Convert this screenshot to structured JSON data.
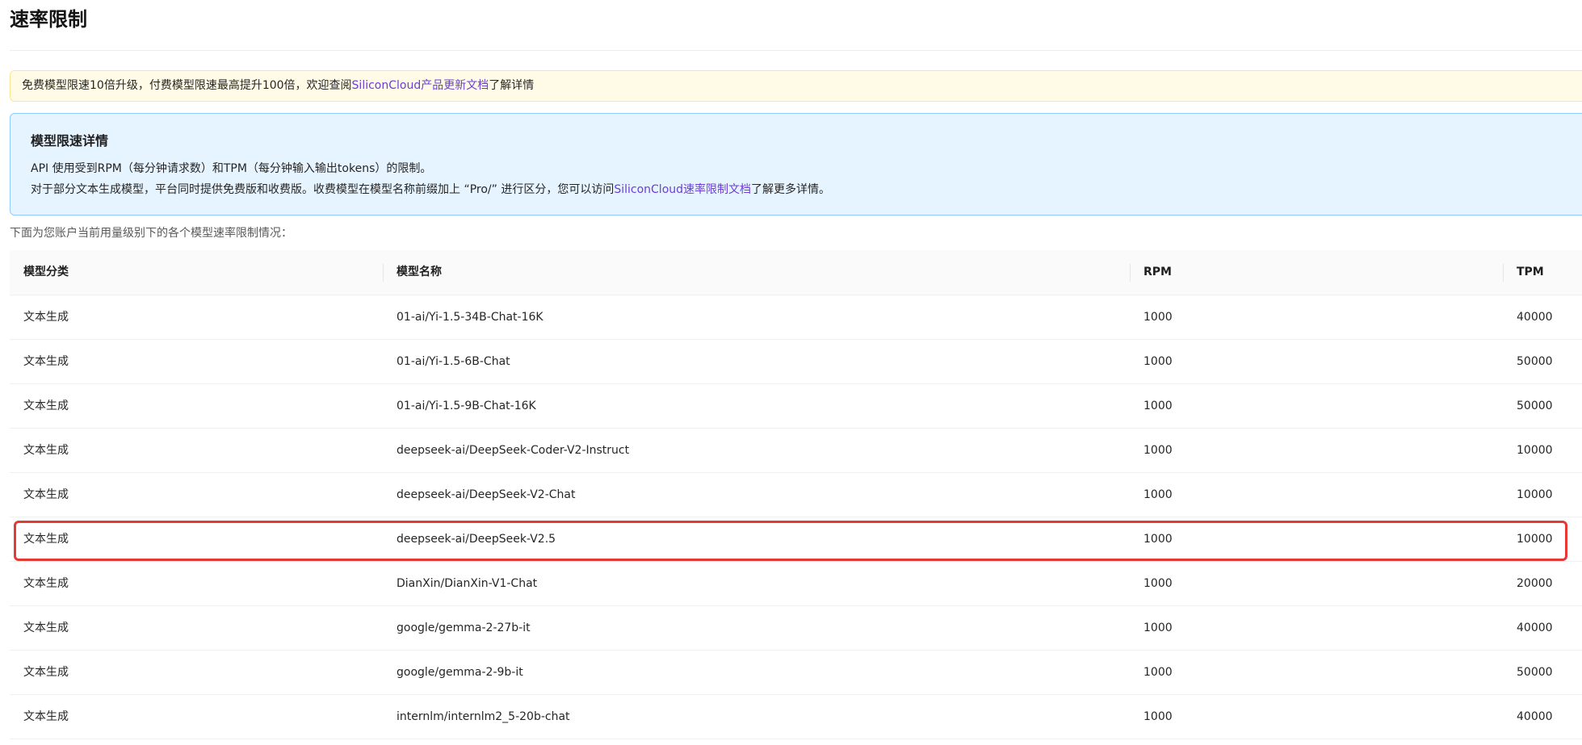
{
  "page": {
    "title": "速率限制"
  },
  "notice": {
    "text_before": "免费模型限速10倍升级，付费模型限速最高提升100倍，欢迎查阅",
    "link_text": "SiliconCloud产品更新文档",
    "text_after": "了解详情"
  },
  "info": {
    "title": "模型限速详情",
    "line1": "API 使用受到RPM（每分钟请求数）和TPM（每分钟输入输出tokens）的限制。",
    "line2_before": "对于部分文本生成模型，平台同时提供免费版和收费版。收费模型在模型名称前缀加上 “Pro/” 进行区分，您可以访问",
    "line2_link": "SiliconCloud速率限制文档",
    "line2_after": "了解更多详情。"
  },
  "table": {
    "caption": "下面为您账户当前用量级别下的各个模型速率限制情况：",
    "headers": {
      "category": "模型分类",
      "model": "模型名称",
      "rpm": "RPM",
      "tpm": "TPM"
    },
    "rows": [
      {
        "category": "文本生成",
        "model": "01-ai/Yi-1.5-34B-Chat-16K",
        "rpm": "1000",
        "tpm": "40000"
      },
      {
        "category": "文本生成",
        "model": "01-ai/Yi-1.5-6B-Chat",
        "rpm": "1000",
        "tpm": "50000"
      },
      {
        "category": "文本生成",
        "model": "01-ai/Yi-1.5-9B-Chat-16K",
        "rpm": "1000",
        "tpm": "50000"
      },
      {
        "category": "文本生成",
        "model": "deepseek-ai/DeepSeek-Coder-V2-Instruct",
        "rpm": "1000",
        "tpm": "10000"
      },
      {
        "category": "文本生成",
        "model": "deepseek-ai/DeepSeek-V2-Chat",
        "rpm": "1000",
        "tpm": "10000"
      },
      {
        "category": "文本生成",
        "model": "deepseek-ai/DeepSeek-V2.5",
        "rpm": "1000",
        "tpm": "10000"
      },
      {
        "category": "文本生成",
        "model": "DianXin/DianXin-V1-Chat",
        "rpm": "1000",
        "tpm": "20000"
      },
      {
        "category": "文本生成",
        "model": "google/gemma-2-27b-it",
        "rpm": "1000",
        "tpm": "40000"
      },
      {
        "category": "文本生成",
        "model": "google/gemma-2-9b-it",
        "rpm": "1000",
        "tpm": "50000"
      },
      {
        "category": "文本生成",
        "model": "internlm/internlm2_5-20b-chat",
        "rpm": "1000",
        "tpm": "40000"
      }
    ],
    "highlighted_row": 5
  },
  "colors": {
    "link": "#6b3fd6",
    "highlight": "#e53935",
    "notice_bg": "#fffbe6",
    "info_bg": "#e6f4ff"
  }
}
